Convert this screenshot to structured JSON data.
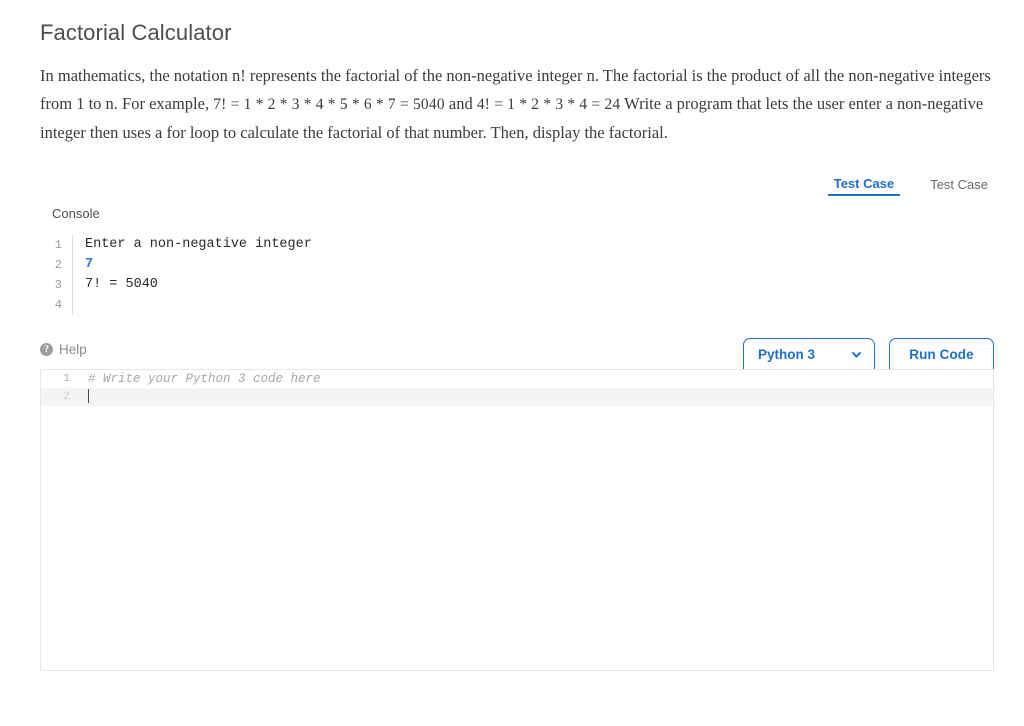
{
  "page": {
    "title": "Factorial Calculator"
  },
  "prompt": {
    "part1": "In mathematics, the notation n! represents the factorial of the non-negative integer n. The factorial is the product of all the non-negative integers from 1 to n. For example, ",
    "math1": "7! = 1 * 2 * 3 * 4 * 5 * 6 * 7 = 5040",
    "part2": " and ",
    "math2": "4! = 1 * 2 * 3 * 4 = 24",
    "part3": " Write a program that lets the user enter a non-negative integer then uses a for loop to calculate the factorial of that number. Then, display the factorial."
  },
  "test_tabs": [
    {
      "label": "Test Case",
      "active": true
    },
    {
      "label": "Test Case",
      "active": false
    }
  ],
  "console": {
    "label": "Console",
    "lines": [
      {
        "num": "1",
        "text": "Enter a non-negative integer",
        "kind": "output"
      },
      {
        "num": "2",
        "text": "7",
        "kind": "input"
      },
      {
        "num": "3",
        "text": "7! = 5040",
        "kind": "output"
      },
      {
        "num": "4",
        "text": "",
        "kind": "output"
      }
    ]
  },
  "toolbar": {
    "help_label": "Help",
    "help_icon": "question-mark-circle-icon",
    "language": "Python 3",
    "language_chevron": "chevron-down-icon",
    "run_label": "Run Code"
  },
  "editor": {
    "lines": [
      {
        "num": "1",
        "text": "# Write your Python 3 code here",
        "comment": true,
        "active": false
      },
      {
        "num": "2",
        "text": "",
        "comment": false,
        "active": true
      }
    ]
  },
  "colors": {
    "accent": "#1f6fd0",
    "console_input": "#2d7ad4",
    "title": "#4d4d4d",
    "body_text": "#3c3c3c",
    "muted": "#8c8c8c"
  }
}
